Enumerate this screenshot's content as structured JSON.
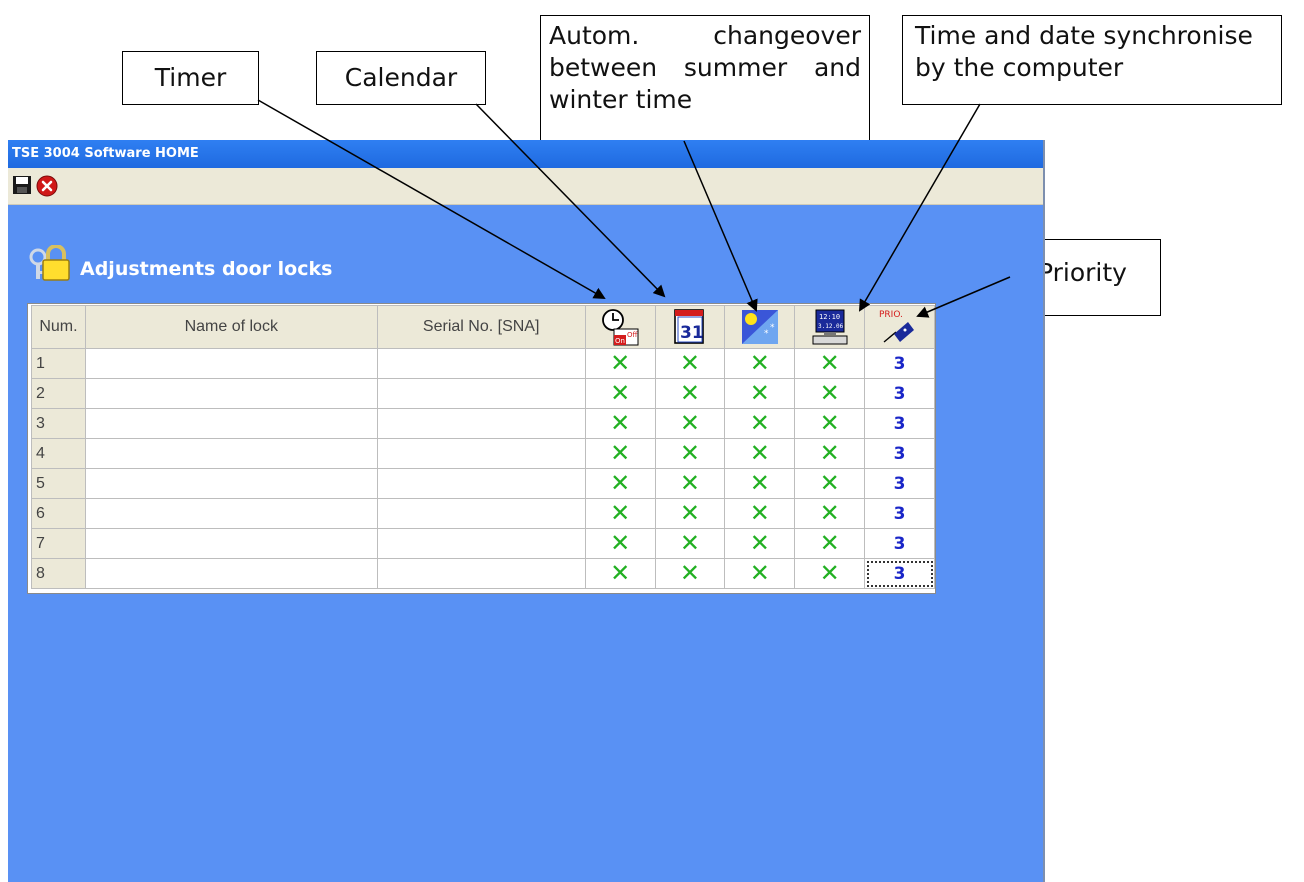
{
  "callouts": {
    "timer": "Timer",
    "calendar": "Calendar",
    "auto": "Autom. changeover between summer and winter time",
    "sync": "Time and date synchronise by the computer",
    "priority": "Priority"
  },
  "window": {
    "title": "TSE 3004 Software HOME",
    "toolbar": {
      "save_icon": "save-icon",
      "close_icon": "close-icon"
    },
    "form_title": "Adjustments door locks",
    "grid": {
      "headers": {
        "num": "Num.",
        "name": "Name of lock",
        "serial": "Serial No. [SNA]",
        "prio_label": "PRIO."
      },
      "header_icons": [
        "timer-icon",
        "calendar-icon",
        "summer-winter-icon",
        "computer-sync-icon",
        "priority-icon"
      ],
      "calendar_day": "31",
      "sync_time": "12:10",
      "sync_date": "3.12.06",
      "timer_on": "On",
      "timer_off": "Off",
      "rows": [
        {
          "num": "1",
          "name": "",
          "serial": "",
          "timer": "✕",
          "calendar": "✕",
          "dst": "✕",
          "sync": "✕",
          "priority": "3"
        },
        {
          "num": "2",
          "name": "",
          "serial": "",
          "timer": "✕",
          "calendar": "✕",
          "dst": "✕",
          "sync": "✕",
          "priority": "3"
        },
        {
          "num": "3",
          "name": "",
          "serial": "",
          "timer": "✕",
          "calendar": "✕",
          "dst": "✕",
          "sync": "✕",
          "priority": "3"
        },
        {
          "num": "4",
          "name": "",
          "serial": "",
          "timer": "✕",
          "calendar": "✕",
          "dst": "✕",
          "sync": "✕",
          "priority": "3"
        },
        {
          "num": "5",
          "name": "",
          "serial": "",
          "timer": "✕",
          "calendar": "✕",
          "dst": "✕",
          "sync": "✕",
          "priority": "3"
        },
        {
          "num": "6",
          "name": "",
          "serial": "",
          "timer": "✕",
          "calendar": "✕",
          "dst": "✕",
          "sync": "✕",
          "priority": "3"
        },
        {
          "num": "7",
          "name": "",
          "serial": "",
          "timer": "✕",
          "calendar": "✕",
          "dst": "✕",
          "sync": "✕",
          "priority": "3"
        },
        {
          "num": "8",
          "name": "",
          "serial": "",
          "timer": "✕",
          "calendar": "✕",
          "dst": "✕",
          "sync": "✕",
          "priority": "3"
        }
      ]
    }
  }
}
